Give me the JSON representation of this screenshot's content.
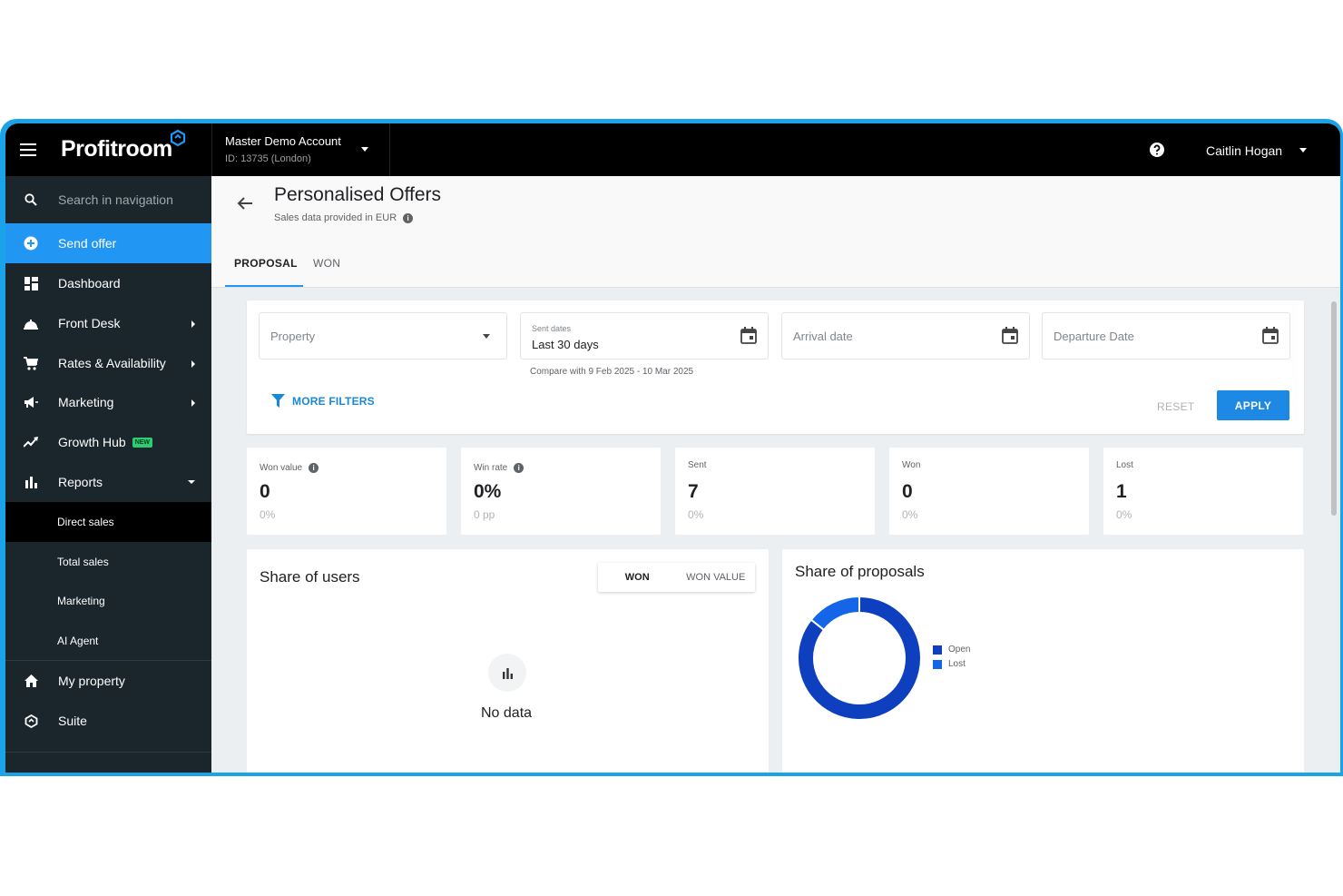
{
  "topbar": {
    "logo_text": "Profitroom",
    "account_name": "Master Demo Account",
    "account_id": "ID: 13735 (London)",
    "user_name": "Caitlin Hogan"
  },
  "sidebar": {
    "search_placeholder": "Search in navigation",
    "send_offer": "Send offer",
    "items": [
      {
        "label": "Dashboard",
        "icon": "dashboard-icon"
      },
      {
        "label": "Front Desk",
        "icon": "bell-icon"
      },
      {
        "label": "Rates & Availability",
        "icon": "cart-icon"
      },
      {
        "label": "Marketing",
        "icon": "megaphone-icon"
      },
      {
        "label": "Growth Hub",
        "icon": "trending-icon",
        "badge": "NEW"
      },
      {
        "label": "Reports",
        "icon": "bar-chart-icon"
      }
    ],
    "report_subitems": [
      "Direct sales",
      "Total sales",
      "Marketing",
      "AI Agent"
    ],
    "bottom_items": [
      {
        "label": "My property",
        "icon": "home-icon"
      },
      {
        "label": "Suite",
        "icon": "suite-icon"
      }
    ]
  },
  "page": {
    "title": "Personalised Offers",
    "subtitle": "Sales data provided in EUR",
    "tabs": [
      "PROPOSAL",
      "WON"
    ],
    "active_tab": "PROPOSAL"
  },
  "filters": {
    "property_placeholder": "Property",
    "sent_dates_label": "Sent dates",
    "sent_dates_value": "Last 30 days",
    "arrival_placeholder": "Arrival date",
    "departure_placeholder": "Departure Date",
    "compare_text": "Compare with 9 Feb 2025 - 10 Mar 2025",
    "more_filters": "MORE FILTERS",
    "reset": "RESET",
    "apply": "APPLY"
  },
  "kpis": [
    {
      "label": "Won value",
      "value": "0",
      "sub": "0%"
    },
    {
      "label": "Win rate",
      "value": "0%",
      "sub": "0 pp"
    },
    {
      "label": "Sent",
      "value": "7",
      "sub": "0%"
    },
    {
      "label": "Won",
      "value": "0",
      "sub": "0%"
    },
    {
      "label": "Lost",
      "value": "1",
      "sub": "0%"
    }
  ],
  "share_users": {
    "title": "Share of users",
    "toggle_won": "WON",
    "toggle_won_value": "WON VALUE",
    "no_data": "No data"
  },
  "share_proposals": {
    "title": "Share of proposals"
  },
  "colors": {
    "accent": "#2196f3",
    "sidebar_bg": "#1b262c",
    "donut_open": "#0d3fbf",
    "donut_lost": "#1565e8"
  },
  "chart_data": {
    "type": "pie",
    "categories": [
      "Open",
      "Lost"
    ],
    "values": [
      6,
      1
    ],
    "legend": "right"
  }
}
